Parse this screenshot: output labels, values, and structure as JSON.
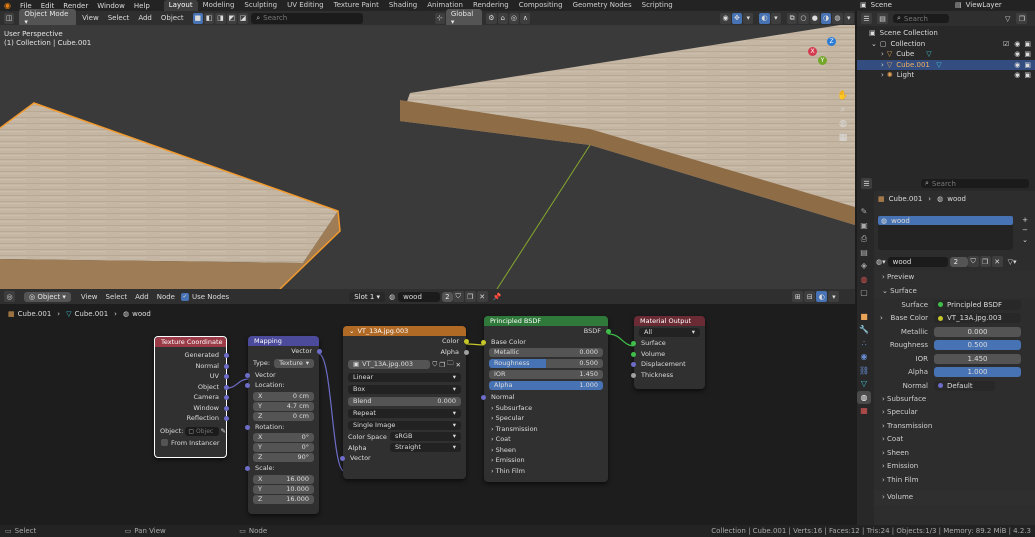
{
  "topbar": {
    "menu": [
      "File",
      "Edit",
      "Render",
      "Window",
      "Help"
    ],
    "workspaces": [
      "Layout",
      "Modeling",
      "Sculpting",
      "UV Editing",
      "Texture Paint",
      "Shading",
      "Animation",
      "Rendering",
      "Compositing",
      "Geometry Nodes",
      "Scripting"
    ],
    "scene": "Scene",
    "view_layer": "ViewLayer"
  },
  "viewport": {
    "mode": "Object Mode",
    "menus": [
      "View",
      "Select",
      "Add",
      "Object"
    ],
    "search_placeholder": "Search",
    "transform_orientation": "Global",
    "overlay_title": "User Perspective",
    "overlay_sub": "(1) Collection | Cube.001",
    "gizmo": {
      "x": "X",
      "y": "Y",
      "z": "Z"
    }
  },
  "node_editor": {
    "editor_type": "Object",
    "menus": [
      "View",
      "Select",
      "Add",
      "Node"
    ],
    "use_nodes": "Use Nodes",
    "slot": "Slot 1",
    "material": "wood",
    "users": "2",
    "breadcrumb": [
      "Cube.001",
      "Cube.001",
      "wood"
    ],
    "tex_coord": {
      "title": "Texture Coordinate",
      "outputs": [
        "Generated",
        "Normal",
        "UV",
        "Object",
        "Camera",
        "Window",
        "Reflection"
      ],
      "object_label": "Object:",
      "object_placeholder": "Objec",
      "from_instancer": "From Instancer"
    },
    "mapping": {
      "title": "Mapping",
      "output": "Vector",
      "type_label": "Type:",
      "type_value": "Texture",
      "input_vector": "Vector",
      "location_label": "Location:",
      "location": [
        {
          "a": "X",
          "v": "0 cm"
        },
        {
          "a": "Y",
          "v": "4.7 cm"
        },
        {
          "a": "Z",
          "v": "0 cm"
        }
      ],
      "rotation_label": "Rotation:",
      "rotation": [
        {
          "a": "X",
          "v": "0°"
        },
        {
          "a": "Y",
          "v": "0°"
        },
        {
          "a": "Z",
          "v": "90°"
        }
      ],
      "scale_label": "Scale:",
      "scale": [
        {
          "a": "X",
          "v": "16.000"
        },
        {
          "a": "Y",
          "v": "10.000"
        },
        {
          "a": "Z",
          "v": "16.000"
        }
      ]
    },
    "image_tex": {
      "title": "VT_13A.jpg.003",
      "out_color": "Color",
      "out_alpha": "Alpha",
      "image": "VT_13A.jpg.003",
      "interpolation": "Linear",
      "projection": "Box",
      "blend_label": "Blend",
      "blend_value": "0.000",
      "extension": "Repeat",
      "source": "Single Image",
      "colorspace_label": "Color Space",
      "colorspace": "sRGB",
      "alpha_label": "Alpha",
      "alpha_mode": "Straight",
      "input_vector": "Vector"
    },
    "bsdf": {
      "title": "Principled BSDF",
      "output": "BSDF",
      "base_color": "Base Color",
      "fields": [
        {
          "label": "Metallic",
          "value": "0.000",
          "fill": 0
        },
        {
          "label": "Roughness",
          "value": "0.500",
          "fill": 0.5
        },
        {
          "label": "IOR",
          "value": "1.450",
          "fill": 0
        },
        {
          "label": "Alpha",
          "value": "1.000",
          "fill": 1
        }
      ],
      "normal": "Normal",
      "panels": [
        "Subsurface",
        "Specular",
        "Transmission",
        "Coat",
        "Sheen",
        "Emission",
        "Thin Film"
      ]
    },
    "mat_output": {
      "title": "Material Output",
      "target": "All",
      "inputs": [
        "Surface",
        "Volume",
        "Displacement",
        "Thickness"
      ]
    }
  },
  "outliner": {
    "search_placeholder": "Search",
    "items": [
      {
        "label": "Scene Collection",
        "indent": 0
      },
      {
        "label": "Collection",
        "indent": 1
      },
      {
        "label": "Cube",
        "indent": 2
      },
      {
        "label": "Cube.001",
        "indent": 2,
        "selected": true
      },
      {
        "label": "Light",
        "indent": 2
      }
    ]
  },
  "properties": {
    "search_placeholder": "Search",
    "breadcrumb": [
      "Cube.001",
      "wood"
    ],
    "slot_name": "wood",
    "material_name": "wood",
    "users": "2",
    "sections": {
      "preview": "Preview",
      "surface": "Surface",
      "volume": "Volume"
    },
    "surface_label": "Surface",
    "surface_value": "Principled BSDF",
    "rows": [
      {
        "label": "Base Color",
        "value": "VT_13A.jpg.003"
      },
      {
        "label": "Metallic",
        "value": "0.000",
        "blue": false
      },
      {
        "label": "Roughness",
        "value": "0.500",
        "blue": true
      },
      {
        "label": "IOR",
        "value": "1.450",
        "blue": false
      },
      {
        "label": "Alpha",
        "value": "1.000",
        "blue": true
      },
      {
        "label": "Normal",
        "value": "Default"
      }
    ],
    "subpanels": [
      "Subsurface",
      "Specular",
      "Transmission",
      "Coat",
      "Sheen",
      "Emission",
      "Thin Film"
    ]
  },
  "statusbar": {
    "select": "Select",
    "pan": "Pan View",
    "node": "Node",
    "stats": "Collection | Cube.001 | Verts:16 | Faces:12 | Tris:24 | Objects:1/3 | Memory: 89.2 MiB | 4.2.3"
  },
  "colors": {
    "accent": "#4772b3",
    "texcoord_header": "#9b3b47",
    "mapping_header": "#4b4a9b",
    "image_header": "#b06a26",
    "bsdf_header": "#2f7a3a",
    "output_header": "#6a2b34",
    "wood": "#c7b9a6",
    "selection": "#f29a2e"
  }
}
